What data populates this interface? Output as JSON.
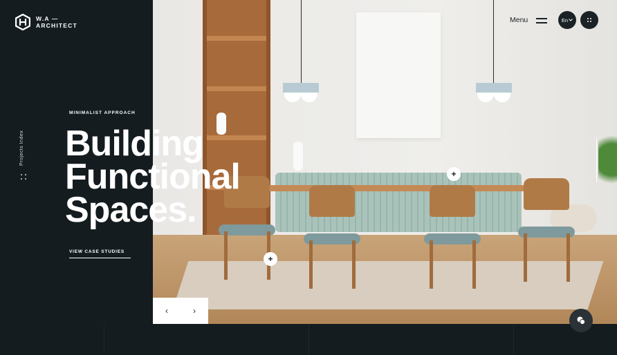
{
  "brand": {
    "name_line1": "W.A —",
    "name_line2": "ARCHITECT",
    "logo_icon": "hexagon-logo-icon"
  },
  "sidebar": {
    "vertical_label": "Projects Index",
    "dots_icon": "grid-dots-icon"
  },
  "hero": {
    "eyebrow": "MINIMALIST APPROACH",
    "headline_line1": "Building",
    "headline_line2": "Functional",
    "headline_line3": "Spaces.",
    "cta_label": "VIEW CASE STUDIES"
  },
  "header": {
    "menu_label": "Menu",
    "menu_icon": "hamburger-icon",
    "lang_label": "En",
    "apps_icon": "grid-dots-icon"
  },
  "hotspots": [
    {
      "label": "+"
    },
    {
      "label": "+"
    }
  ],
  "slider": {
    "prev_icon": "chevron-left-icon",
    "prev_glyph": "‹",
    "next_icon": "chevron-right-icon",
    "next_glyph": "›"
  },
  "chat": {
    "icon": "chat-bubble-icon"
  },
  "colors": {
    "panel_bg": "#141c20",
    "accent_dark": "#1b2226",
    "text_light": "#ffffff"
  }
}
